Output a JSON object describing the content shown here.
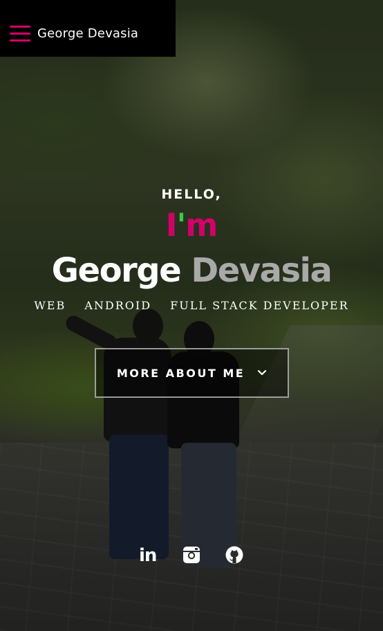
{
  "header": {
    "menu_icon": "hamburger-menu-icon",
    "brand": "George Devasia",
    "accent_color": "#d4006a"
  },
  "hero": {
    "greeting": "HELLO,",
    "im": {
      "i": "I",
      "apostrophe": "'",
      "m": "m",
      "apostrophe_color": "#3ec845"
    },
    "name_first": "George",
    "name_last": "Devasia",
    "roles": [
      "WEB",
      "ANDROID",
      "FULL STACK DEVELOPER"
    ],
    "cta_label": "MORE ABOUT ME",
    "cta_icon": "chevron-down-icon"
  },
  "social": [
    {
      "name": "linkedin",
      "icon": "linkedin-icon",
      "label": "in"
    },
    {
      "name": "instagram",
      "icon": "instagram-icon"
    },
    {
      "name": "github",
      "icon": "github-icon"
    }
  ]
}
